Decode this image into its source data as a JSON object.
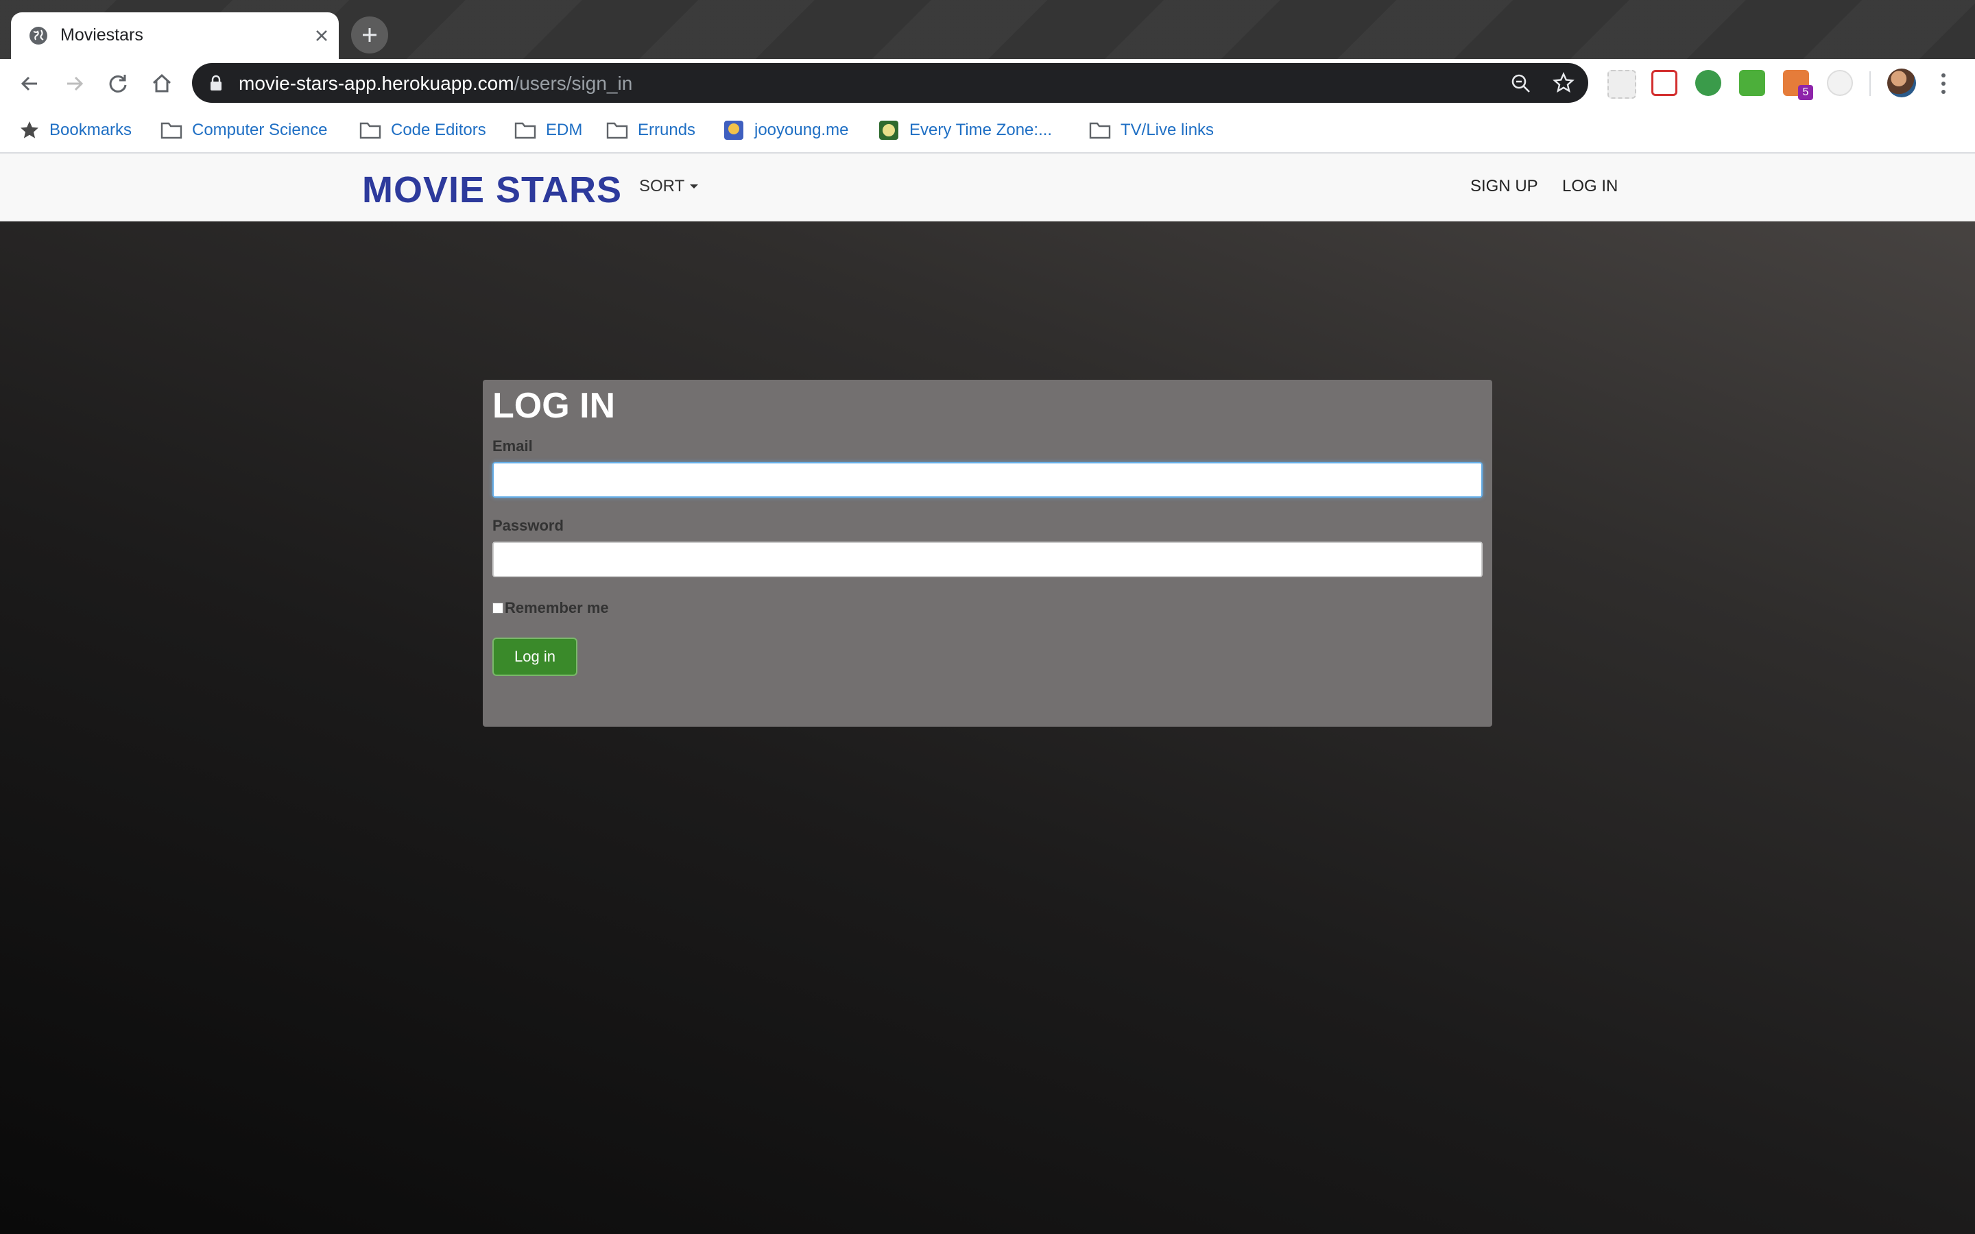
{
  "browser": {
    "tab_title": "Moviestars",
    "url_host": "movie-stars-app.herokuapp.com",
    "url_path": "/users/sign_in",
    "extension_badge": "5",
    "bookmarks": [
      {
        "label": "Bookmarks",
        "icon": "star-icon"
      },
      {
        "label": "Computer Science",
        "icon": "folder-icon"
      },
      {
        "label": "Code Editors",
        "icon": "folder-icon"
      },
      {
        "label": "EDM",
        "icon": "folder-icon"
      },
      {
        "label": "Errunds",
        "icon": "folder-icon"
      },
      {
        "label": "jooyoung.me",
        "icon": "site-icon"
      },
      {
        "label": "Every Time Zone:...",
        "icon": "site-icon"
      },
      {
        "label": "TV/Live links",
        "icon": "folder-icon"
      }
    ]
  },
  "navbar": {
    "brand": "MOVIE STARS",
    "sort_label": "SORT",
    "signup_label": "SIGN UP",
    "login_label": "LOG IN"
  },
  "login_form": {
    "heading": "LOG IN",
    "email_label": "Email",
    "password_label": "Password",
    "remember_label": "Remember me",
    "submit_label": "Log in"
  },
  "colors": {
    "brand": "#2d3a9c",
    "submit_bg": "#3a8a2a",
    "panel_bg": "#737070",
    "omnibox_bg": "#202124"
  }
}
